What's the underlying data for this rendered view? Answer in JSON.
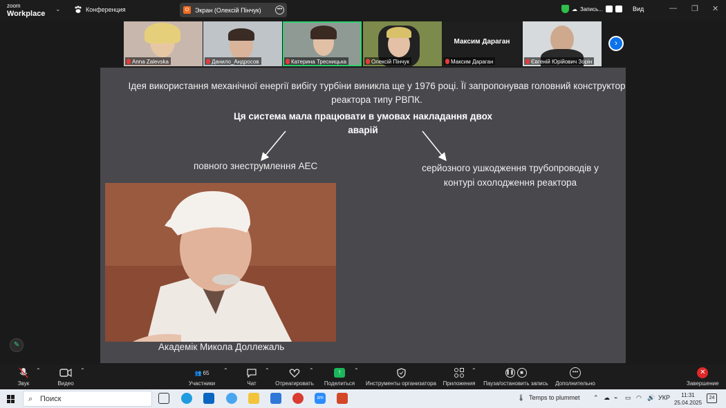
{
  "app": {
    "logo_top": "zoom",
    "logo_bottom": "Workplace",
    "conference_label": "Конференция",
    "share_badge": "O",
    "share_label": "Экран (Олексій Пінчук)",
    "recording_label": "Запись...",
    "view_label": "Вид"
  },
  "participants": [
    {
      "name": "Anna Zalevska"
    },
    {
      "name": "Данило_Андросов"
    },
    {
      "name": "Катерина Тресницька"
    },
    {
      "name": "Олексій Пінчук"
    },
    {
      "name": "Максим Дараган",
      "big_name": "Максим Дараган"
    },
    {
      "name": "Євгеній Юрійович Зорін"
    }
  ],
  "slide": {
    "paragraph": "Ідея використання механічної енергії вибігу турбіни виникла ще у 1976 році. Її запропонував головний конструктор реактора типу РВПК.",
    "bold_statement": "Ця система мала працювати в умовах накладання двох аварій",
    "item_left": "повного знеструмлення АЕС",
    "item_right": "серйозного ушкодження трубопроводів у контурі охолодження реактора",
    "photo_caption": "Академік Микола Доллежаль"
  },
  "toolbar": {
    "audio": "Звук",
    "video": "Видео",
    "participants": "Участники",
    "participants_count": "65",
    "chat": "Чат",
    "react": "Отреагировать",
    "share": "Поделиться",
    "host_tools": "Инструменты организатора",
    "apps": "Приложения",
    "pause_stop_rec": "Пауза/остановить запись",
    "more": "Дополнительно",
    "end": "Завершение"
  },
  "taskbar": {
    "search_placeholder": "Поиск",
    "weather": "Temps to plummet",
    "lang": "УКР",
    "time": "11:31",
    "date": "25.04.2025",
    "notifications": "24"
  },
  "colors": {
    "accent_blue": "#0e72ed",
    "active_green": "#2dd36f",
    "end_red": "#e02828",
    "slide_bg": "#48484d"
  }
}
